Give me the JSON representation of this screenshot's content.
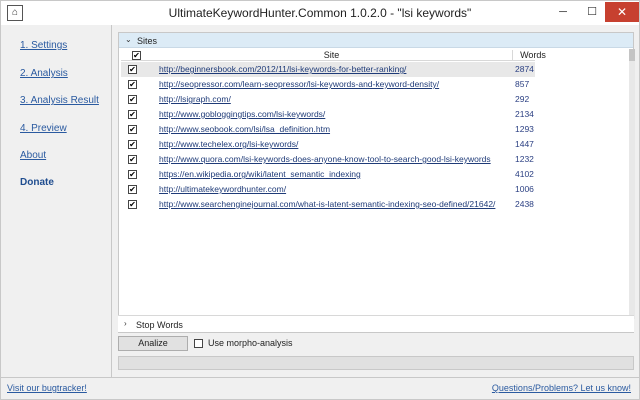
{
  "window": {
    "title": "UltimateKeywordHunter.Common 1.0.2.0 - \"lsi keywords\"",
    "minimize_glyph": "─",
    "maximize_glyph": "☐",
    "close_glyph": "✕"
  },
  "nav": {
    "items": [
      {
        "label": "1. Settings",
        "active": false
      },
      {
        "label": "2. Analysis",
        "active": false
      },
      {
        "label": "3. Analysis Result",
        "active": false
      },
      {
        "label": "4. Preview",
        "active": false
      },
      {
        "label": "About",
        "active": false
      },
      {
        "label": "Donate",
        "active": true
      }
    ]
  },
  "sites": {
    "header_label": "Sites",
    "col_site": "Site",
    "col_words": "Words",
    "all_checked": true,
    "rows": [
      {
        "checked": true,
        "url": "http://beginnersbook.com/2012/11/lsi-keywords-for-better-ranking/",
        "words": "2874",
        "selected": true
      },
      {
        "checked": true,
        "url": "http://seopressor.com/learn-seopressor/lsi-keywords-and-keyword-density/",
        "words": "857",
        "selected": false
      },
      {
        "checked": true,
        "url": "http://lsigraph.com/",
        "words": "292",
        "selected": false
      },
      {
        "checked": true,
        "url": "http://www.gobloggingtips.com/lsi-keywords/",
        "words": "2134",
        "selected": false
      },
      {
        "checked": true,
        "url": "http://www.seobook.com/lsi/lsa_definition.htm",
        "words": "1293",
        "selected": false
      },
      {
        "checked": true,
        "url": "http://www.techelex.org/lsi-keywords/",
        "words": "1447",
        "selected": false
      },
      {
        "checked": true,
        "url": "http://www.quora.com/lsi-keywords-does-anyone-know-tool-to-search-good-lsi-keywords",
        "words": "1232",
        "selected": false
      },
      {
        "checked": true,
        "url": "https://en.wikipedia.org/wiki/latent_semantic_indexing",
        "words": "4102",
        "selected": false
      },
      {
        "checked": true,
        "url": "http://ultimatekeywordhunter.com/",
        "words": "1006",
        "selected": false
      },
      {
        "checked": true,
        "url": "http://www.searchenginejournal.com/what-is-latent-semantic-indexing-seo-defined/21642/",
        "words": "2438",
        "selected": false
      }
    ]
  },
  "stop_words": {
    "label": "Stop Words"
  },
  "controls": {
    "analize_label": "Analize",
    "morpho_label": "Use morpho-analysis",
    "morpho_checked": false,
    "progress_fraction": 0
  },
  "footer": {
    "left_link": "Visit our bugtracker!",
    "right_link": "Questions/Problems? Let us know!"
  }
}
